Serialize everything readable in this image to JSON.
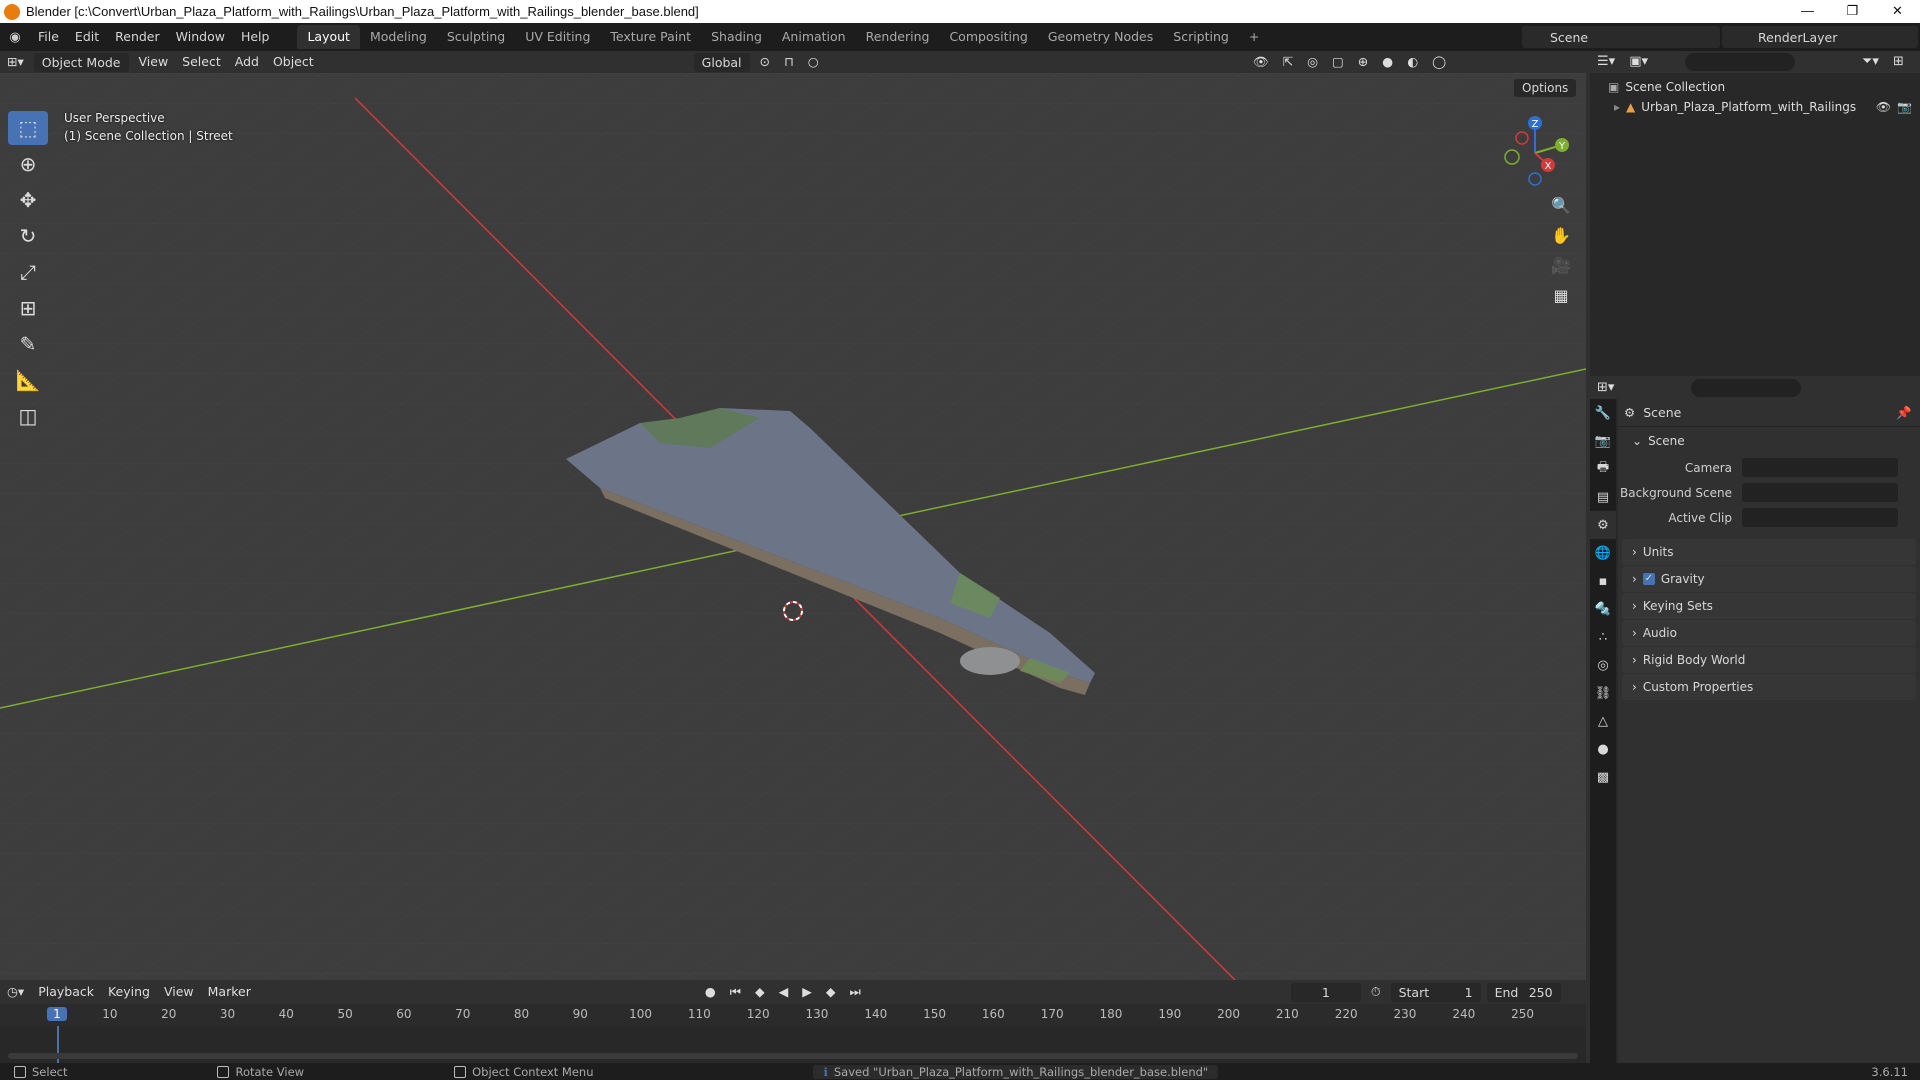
{
  "window": {
    "title": "Blender [c:\\Convert\\Urban_Plaza_Platform_with_Railings\\Urban_Plaza_Platform_with_Railings_blender_base.blend]",
    "controls": [
      "—",
      "❐",
      "✕"
    ]
  },
  "menu": [
    "File",
    "Edit",
    "Render",
    "Window",
    "Help"
  ],
  "workspaces": [
    "Layout",
    "Modeling",
    "Sculpting",
    "UV Editing",
    "Texture Paint",
    "Shading",
    "Animation",
    "Rendering",
    "Compositing",
    "Geometry Nodes",
    "Scripting",
    "+"
  ],
  "scene_name": "Scene",
  "render_layer": "RenderLayer",
  "viewport_header": {
    "mode": "Object Mode",
    "menus": [
      "View",
      "Select",
      "Add",
      "Object"
    ],
    "orientation": "Global",
    "options": "Options"
  },
  "viewport": {
    "perspective": "User Perspective",
    "collection_info": "(1) Scene Collection | Street"
  },
  "gizmo": {
    "x": "X",
    "y": "Y",
    "z": "Z"
  },
  "outliner": {
    "root": "Scene Collection",
    "items": [
      "Urban_Plaza_Platform_with_Railings"
    ]
  },
  "properties": {
    "title": "Scene",
    "panel": "Scene",
    "fields": [
      {
        "label": "Camera",
        "value": ""
      },
      {
        "label": "Background Scene",
        "value": ""
      },
      {
        "label": "Active Clip",
        "value": ""
      }
    ],
    "sections": [
      "Units",
      "Gravity",
      "Keying Sets",
      "Audio",
      "Rigid Body World",
      "Custom Properties"
    ]
  },
  "timeline": {
    "menus": [
      "Playback",
      "Keying",
      "View",
      "Marker"
    ],
    "current_frame": "1",
    "start_label": "Start",
    "start": "1",
    "end_label": "End",
    "end": "250",
    "ticks": [
      "1",
      "10",
      "20",
      "30",
      "40",
      "50",
      "60",
      "70",
      "80",
      "90",
      "100",
      "110",
      "120",
      "130",
      "140",
      "150",
      "160",
      "170",
      "180",
      "190",
      "200",
      "210",
      "220",
      "230",
      "240",
      "250"
    ]
  },
  "status": {
    "select": "Select",
    "rotate": "Rotate View",
    "context": "Object Context Menu",
    "saved": "Saved \"Urban_Plaza_Platform_with_Railings_blender_base.blend\"",
    "version": "3.6.11"
  },
  "colors": {
    "accent": "#4772b3",
    "x_axis": "#d23a3a",
    "y_axis": "#7dae2f",
    "z_axis": "#2f6fd2"
  }
}
